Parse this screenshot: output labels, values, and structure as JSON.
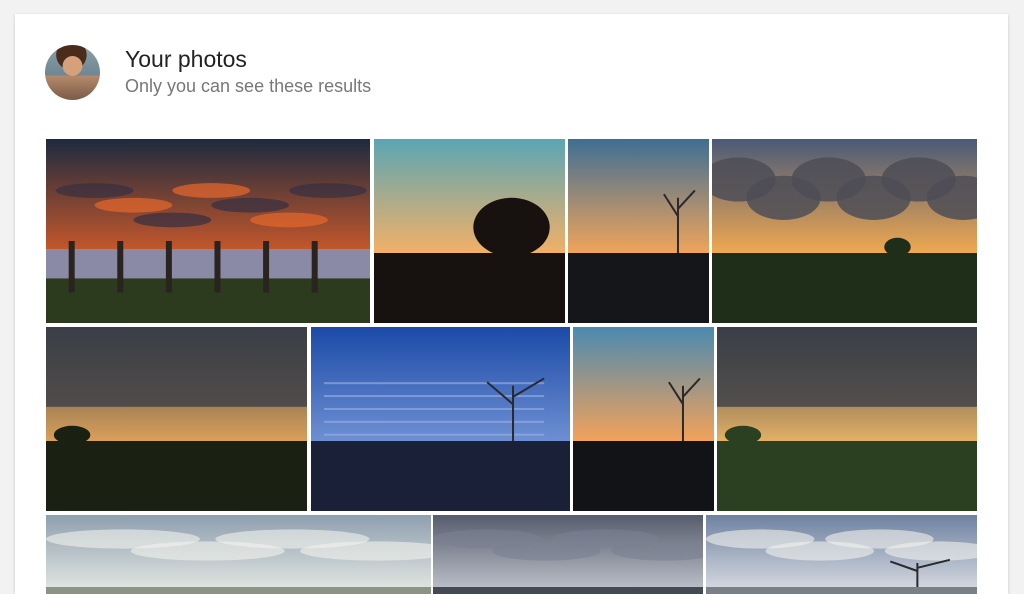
{
  "header": {
    "title": "Your photos",
    "subtitle": "Only you can see these results"
  },
  "photos": [
    {
      "label": "Sunset clouds over lake with fence posts",
      "sky_top": "#1d2a3f",
      "sky_bottom": "#c8582a",
      "ground": "#2c3a1e",
      "water": true,
      "clouds": "fiery",
      "tree": "none"
    },
    {
      "label": "Dusk sky with tree silhouette",
      "sky_top": "#5aa6b4",
      "sky_bottom": "#f2b067",
      "ground": "#17120f",
      "water": false,
      "clouds": "none",
      "tree": "large-right"
    },
    {
      "label": "Sunset horizon with bare tree",
      "sky_top": "#3e6e94",
      "sky_bottom": "#f0a45a",
      "ground": "#15161a",
      "water": false,
      "clouds": "none",
      "tree": "bare-right"
    },
    {
      "label": "Dramatic clouds at sunset over field",
      "sky_top": "#4a5a78",
      "sky_bottom": "#f0a850",
      "ground": "#1f2e18",
      "water": false,
      "clouds": "heavy",
      "tree": "small-mid"
    },
    {
      "label": "Overcast dusk over hills",
      "sky_top": "#3a3e48",
      "sky_bottom": "#d9a05a",
      "ground": "#1a2012",
      "water": false,
      "clouds": "overcast",
      "tree": "left"
    },
    {
      "label": "Blue twilight sky",
      "sky_top": "#1c4aa8",
      "sky_bottom": "#6e8fd2",
      "ground": "#1a2038",
      "water": false,
      "clouds": "streaks",
      "tree": "bare-right"
    },
    {
      "label": "Sunset with bare tree over town",
      "sky_top": "#4b8ab0",
      "sky_bottom": "#f2a25a",
      "ground": "#111316",
      "water": false,
      "clouds": "none",
      "tree": "bare-right"
    },
    {
      "label": "Overcast evening over green field",
      "sky_top": "#3a3f48",
      "sky_bottom": "#e2b066",
      "ground": "#2a4020",
      "water": false,
      "clouds": "overcast",
      "tree": "left"
    },
    {
      "label": "Pale cloudy sky",
      "sky_top": "#8e9fae",
      "sky_bottom": "#dfe3e0",
      "ground": "#8c9486",
      "water": false,
      "clouds": "bright",
      "tree": "none"
    },
    {
      "label": "Grey cloudy dusk",
      "sky_top": "#565c6c",
      "sky_bottom": "#b8bcc6",
      "ground": "#444a52",
      "water": false,
      "clouds": "dark",
      "tree": "none"
    },
    {
      "label": "Light cloudy sky with tree",
      "sky_top": "#6e82a0",
      "sky_bottom": "#d2d6de",
      "ground": "#7a8088",
      "water": false,
      "clouds": "bright",
      "tree": "bare-right"
    }
  ]
}
